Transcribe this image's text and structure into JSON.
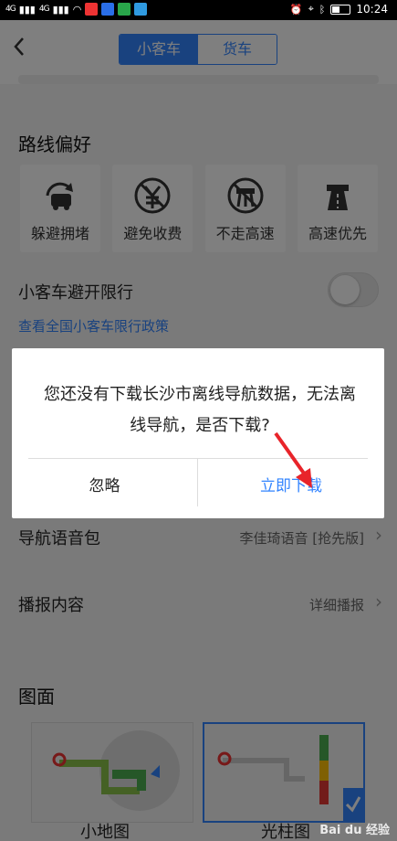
{
  "status_bar": {
    "time": "10:24",
    "signal1": "4G",
    "signal2": "4G"
  },
  "header": {
    "tabs": [
      {
        "label": "小客车",
        "active": true
      },
      {
        "label": "货车",
        "active": false
      }
    ]
  },
  "route_pref": {
    "title": "路线偏好",
    "options": [
      {
        "label": "躲避拥堵",
        "icon": "avoid-congestion-icon"
      },
      {
        "label": "避免收费",
        "icon": "no-toll-icon"
      },
      {
        "label": "不走高速",
        "icon": "no-highway-icon"
      },
      {
        "label": "高速优先",
        "icon": "highway-first-icon"
      }
    ]
  },
  "restriction": {
    "label": "小客车避开限行",
    "toggle_on": false,
    "policy_link": "查看全国小客车限行政策"
  },
  "voice": {
    "label": "导航语音包",
    "value": "李佳琦语音 [抢先版]"
  },
  "broadcast": {
    "label": "播报内容",
    "value": "详细播报"
  },
  "display": {
    "title": "图面",
    "options": [
      {
        "label": "小地图",
        "selected": false
      },
      {
        "label": "光柱图",
        "selected": true
      }
    ]
  },
  "dialog": {
    "message": "您还没有下载长沙市离线导航数据，无法离线导航，是否下载?",
    "ignore_label": "忽略",
    "download_label": "立即下载"
  },
  "watermark": "Bai du 经验",
  "colors": {
    "accent": "#3385ff",
    "annotation_arrow": "#e8242a"
  }
}
